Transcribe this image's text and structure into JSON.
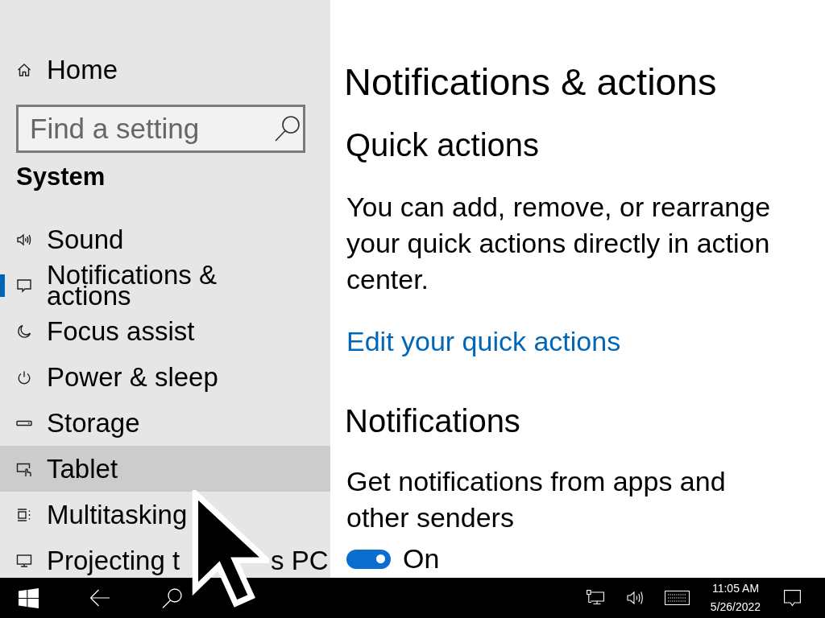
{
  "sidebar": {
    "home": {
      "label": "Home"
    },
    "search": {
      "placeholder": "Find a setting"
    },
    "section_title": "System",
    "items": [
      {
        "label": "Sound",
        "selected": false,
        "hovered": false
      },
      {
        "label": "Notifications & actions",
        "selected": true,
        "hovered": false
      },
      {
        "label": "Focus assist",
        "selected": false,
        "hovered": false
      },
      {
        "label": "Power & sleep",
        "selected": false,
        "hovered": false
      },
      {
        "label": "Storage",
        "selected": false,
        "hovered": false
      },
      {
        "label": "Tablet",
        "selected": false,
        "hovered": true
      },
      {
        "label": "Multitasking",
        "selected": false,
        "hovered": false
      },
      {
        "label": "Projecting t",
        "label_after_cursor": "s PC",
        "selected": false,
        "hovered": false
      }
    ]
  },
  "content": {
    "title": "Notifications & actions",
    "quick_actions": {
      "heading": "Quick actions",
      "description": "You can add, remove, or rearrange your quick actions directly in action center.",
      "link": "Edit your quick actions"
    },
    "notifications": {
      "heading": "Notifications",
      "setting": {
        "label": "Get notifications from apps and other senders",
        "on": true,
        "state_text": "On"
      }
    }
  },
  "taskbar": {
    "clock": {
      "time": "11:05 AM",
      "date": "5/26/2022"
    }
  }
}
